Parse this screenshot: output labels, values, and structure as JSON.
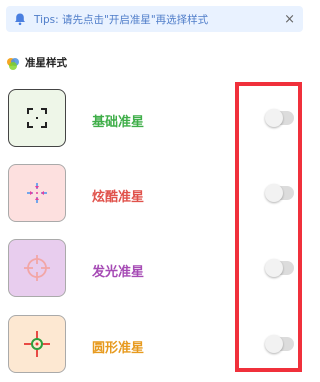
{
  "tip": {
    "text": "Tips: 请先点击\"开启准星\"再选择样式",
    "close_label": "×"
  },
  "section": {
    "title": "准星样式"
  },
  "crosshairs": [
    {
      "label": "基础准星",
      "label_color": "#3fae49",
      "bg": "#eef6e8",
      "border": "#444444",
      "icon": "basic-crosshair-icon",
      "enabled": false
    },
    {
      "label": "炫酷准星",
      "label_color": "#e0524b",
      "bg": "#fde0df",
      "border": "#aaaaaa",
      "icon": "cool-crosshair-icon",
      "enabled": false
    },
    {
      "label": "发光准星",
      "label_color": "#a64bb5",
      "bg": "#e8cdee",
      "border": "#aaaaaa",
      "icon": "glow-crosshair-icon",
      "enabled": false
    },
    {
      "label": "圆形准星",
      "label_color": "#e79a1e",
      "bg": "#fde8d2",
      "border": "#aaaaaa",
      "icon": "circle-crosshair-icon",
      "enabled": false
    }
  ],
  "colors": {
    "highlight_border": "#f0303b",
    "tip_bg": "#e9f2ff",
    "tip_text": "#4f7dc9"
  }
}
